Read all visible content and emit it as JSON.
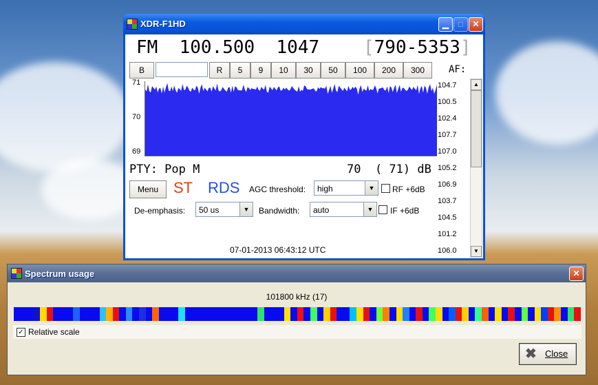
{
  "xdr_window": {
    "title": "XDR-F1HD",
    "band": "FM",
    "frequency": "100.500",
    "pi_code": "1047",
    "rds_ps_bracket_open": "[",
    "rds_ps": "790-5353",
    "rds_ps_bracket_close": "]",
    "step_buttons": [
      "B",
      "R",
      "5",
      "9",
      "10",
      "30",
      "50",
      "100",
      "200",
      "300"
    ],
    "freq_input_value": "",
    "af_label": "AF:",
    "graph_y_labels": [
      "71",
      "70",
      "69"
    ],
    "signal_history": [
      0.93,
      0.88,
      0.95,
      0.9,
      0.86,
      0.92,
      0.94,
      0.89,
      0.91,
      0.87,
      0.9,
      0.95,
      0.85,
      0.92,
      0.88,
      0.93,
      0.96,
      0.9,
      0.87,
      0.91,
      0.89,
      0.94,
      0.92,
      0.86,
      0.9,
      0.93,
      0.88,
      0.95,
      0.91,
      0.89,
      0.92,
      0.94,
      0.87,
      0.9,
      0.93,
      0.88,
      0.91,
      0.95,
      0.9,
      0.86,
      0.92,
      0.94,
      0.89,
      0.91,
      0.93,
      0.88,
      0.9,
      0.95,
      0.87,
      0.92
    ],
    "af_list": [
      "104.7",
      "100.5",
      "102.4",
      "107.7",
      "107.0",
      "105.2",
      "106.9",
      "103.7",
      "104.5",
      "101.2",
      "106.0"
    ],
    "pty": "PTY: Pop M",
    "signal": "70  ( 71) dB",
    "menu_button": "Menu",
    "stereo_indicator": "ST",
    "rds_indicator": "RDS",
    "agc_label": "AGC threshold:",
    "agc_value": "high",
    "rf_label": "RF +6dB",
    "deemphasis_label": "De-emphasis:",
    "deemphasis_value": "50 us",
    "bandwidth_label": "Bandwidth:",
    "bandwidth_value": "auto",
    "if_label": "IF +6dB",
    "datetime": "07-01-2013 06:43:12 UTC"
  },
  "spectrum_window": {
    "title": "Spectrum usage",
    "frequency_readout": "101800 kHz (17)",
    "relative_scale_label": "Relative scale",
    "relative_scale_checked": true,
    "close_button": "Close",
    "colors": [
      "#0a0af0",
      "#0a0af0",
      "#0a0af0",
      "#11c",
      "#ffdd00",
      "#e81010",
      "#0a0af0",
      "#0a0af0",
      "#0a0af0",
      "#2060ff",
      "#0a0af0",
      "#0a0af0",
      "#0a0af0",
      "#30c0ff",
      "#ffb000",
      "#e81010",
      "#0a0af0",
      "#2a8cff",
      "#0a0af0",
      "#1e2ee0",
      "#0a0af0",
      "#ff6600",
      "#0a0af0",
      "#0a0af0",
      "#0a0af0",
      "#22ddff",
      "#0a0af0",
      "#0a0af0",
      "#0a0af0",
      "#0a0af0",
      "#0a0af0",
      "#0a0af0",
      "#0a0af0",
      "#0a0af0",
      "#0a0af0",
      "#0a0af0",
      "#0a0af0",
      "#30e070",
      "#0a0af0",
      "#0a0af0",
      "#0a0af0",
      "#ffe000",
      "#0a0af0",
      "#f01010",
      "#0a0af0",
      "#40ff60",
      "#0a0af0",
      "#ffd000",
      "#e81010",
      "#0a0af0",
      "#0a0af0",
      "#00c0ff",
      "#ffe000",
      "#e81010",
      "#0a0af0",
      "#70ff40",
      "#ff8000",
      "#0a0af0",
      "#ffe000",
      "#2080ff",
      "#0a0af0",
      "#e81010",
      "#0a0af0",
      "#40ff60",
      "#ffdd00",
      "#0a0af0",
      "#0060ff",
      "#e81010",
      "#ffd000",
      "#0a0af0",
      "#30ff90",
      "#ff6000",
      "#0a0af0",
      "#ffe000",
      "#0a0af0",
      "#e81010",
      "#0a0af0",
      "#60ff40",
      "#0a0af0",
      "#ffe000",
      "#0040ff",
      "#e81010",
      "#ff9000",
      "#0a0af0",
      "#30e070",
      "#e81010"
    ]
  }
}
